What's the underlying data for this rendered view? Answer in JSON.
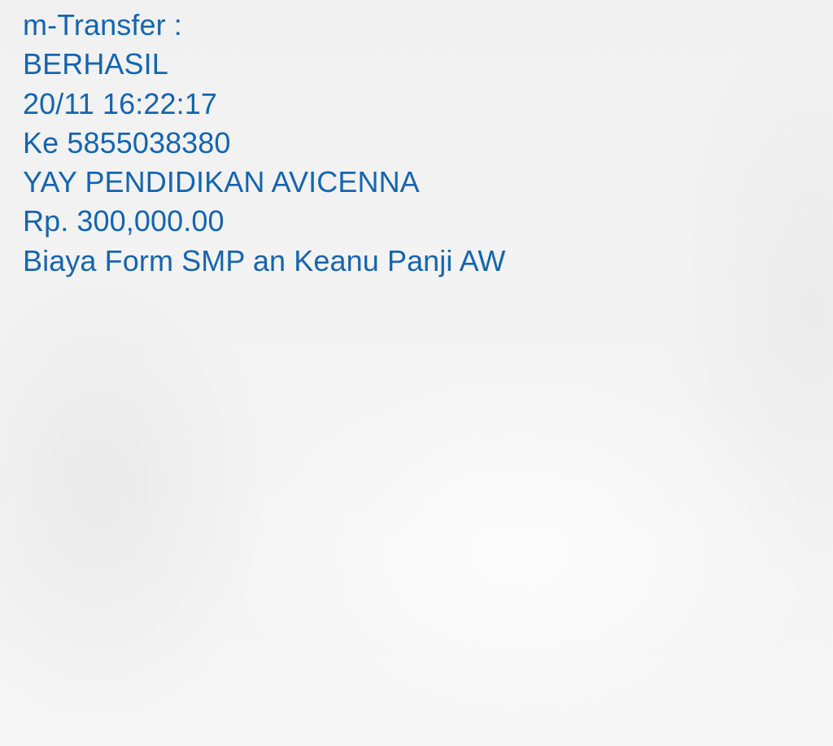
{
  "message": {
    "lines": [
      "m-Transfer :",
      "BERHASIL",
      "20/11 16:22:17",
      "Ke 5855038380",
      "YAY PENDIDIKAN AVICENNA",
      "Rp. 300,000.00",
      "Biaya Form SMP an Keanu Panji AW"
    ]
  },
  "colors": {
    "text": "#1565b0",
    "background": "#f3f3f3"
  }
}
